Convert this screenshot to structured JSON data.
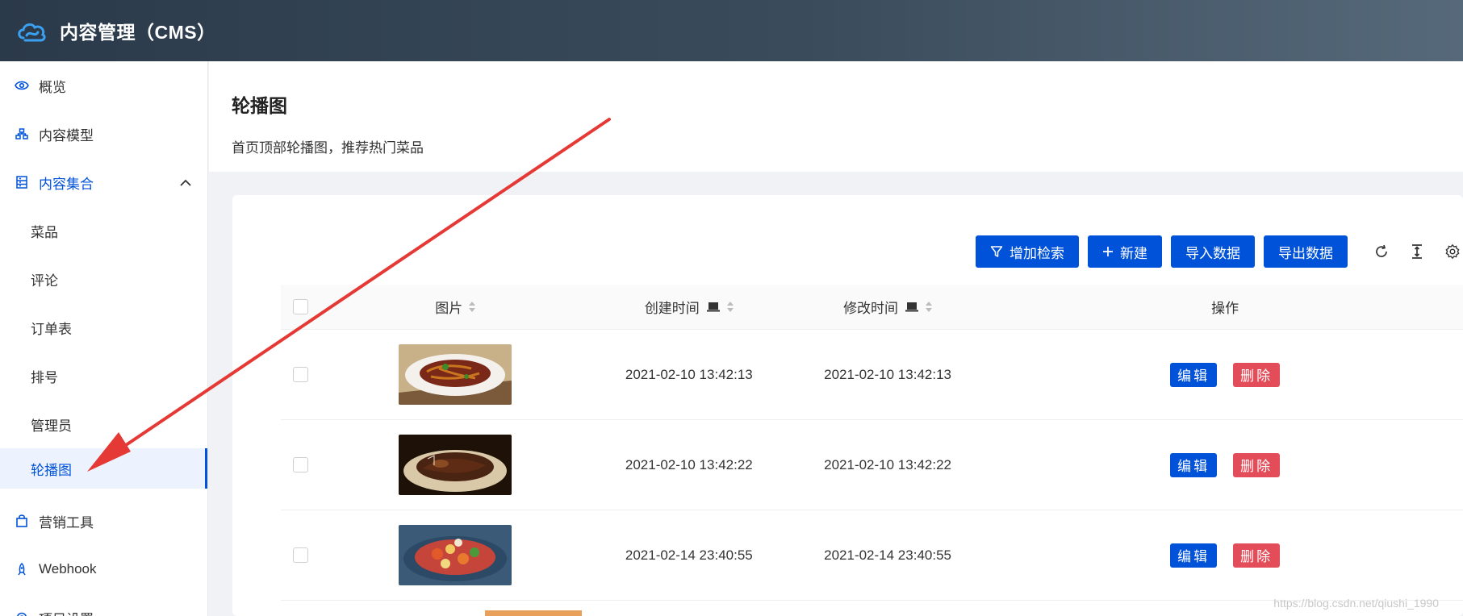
{
  "header": {
    "app_title": "内容管理（CMS）",
    "logo_icon": "cloud-icon"
  },
  "sidebar": {
    "items": [
      {
        "label": "概览",
        "icon": "eye-icon"
      },
      {
        "label": "内容模型",
        "icon": "model-icon"
      },
      {
        "label": "内容集合",
        "icon": "collection-icon"
      }
    ],
    "sub_items": [
      "菜品",
      "评论",
      "订单表",
      "排号",
      "管理员",
      "轮播图"
    ],
    "bottom_items": [
      {
        "label": "营销工具",
        "icon": "bag-icon"
      },
      {
        "label": "Webhook",
        "icon": "webhook-icon"
      },
      {
        "label": "项目设置",
        "icon": "settings-icon"
      }
    ],
    "active_sub": "轮播图"
  },
  "page": {
    "title": "轮播图",
    "description": "首页顶部轮播图，推荐热门菜品"
  },
  "toolbar": {
    "add_search": "增加检索",
    "new": "新建",
    "import": "导入数据",
    "export": "导出数据"
  },
  "table": {
    "headers": {
      "image": "图片",
      "created": "创建时间",
      "modified": "修改时间",
      "ops": "操作"
    },
    "rows": [
      {
        "created": "2021-02-10 13:42:13",
        "modified": "2021-02-10 13:42:13"
      },
      {
        "created": "2021-02-10 13:42:22",
        "modified": "2021-02-10 13:42:22"
      },
      {
        "created": "2021-02-14 23:40:55",
        "modified": "2021-02-14 23:40:55"
      }
    ],
    "edit_label": "编辑",
    "delete_label": "删除"
  },
  "watermark": "https://blog.csdn.net/qiushi_1990",
  "colors": {
    "primary": "#0052d9",
    "danger": "#e34d59",
    "header_bg": "#2b3a4a",
    "arrow": "#e53935"
  }
}
